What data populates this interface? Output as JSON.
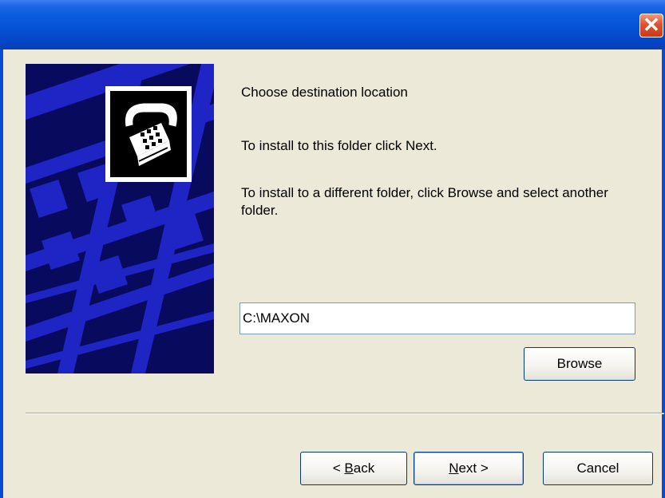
{
  "window": {
    "title": "",
    "close_label": "✕"
  },
  "content": {
    "heading": "Choose destination location",
    "line1": "To install to this folder click Next.",
    "line2": "To install to a different folder, click Browse and select another folder."
  },
  "destination": {
    "value": "C:\\MAXON"
  },
  "buttons": {
    "browse": "Browse",
    "back_prefix": "< ",
    "back_accel": "B",
    "back_rest": "ack",
    "next_accel": "N",
    "next_rest": "ext >",
    "cancel": "Cancel"
  },
  "colors": {
    "banner_bg": "#080a5e",
    "banner_stripes": "#1f25c4",
    "title_bar": "#0650d4"
  }
}
